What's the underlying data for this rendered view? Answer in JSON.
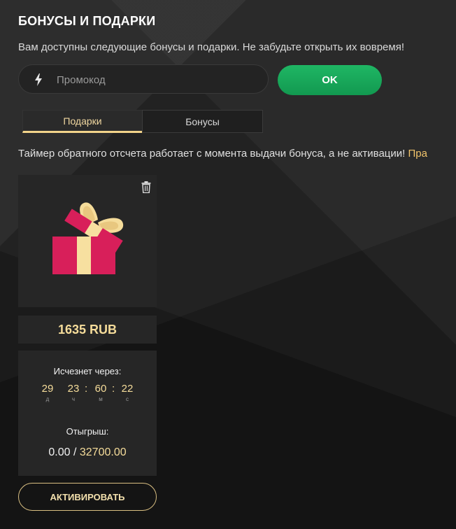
{
  "header": {
    "title": "БОНУСЫ И ПОДАРКИ",
    "subtitle": "Вам доступны следующие бонусы и подарки. Не забудьте открыть их вовремя!"
  },
  "promo": {
    "placeholder": "Промокод",
    "icon": "lightning-icon",
    "ok_label": "OK"
  },
  "tabs": [
    {
      "label": "Подарки",
      "active": true
    },
    {
      "label": "Бонусы",
      "active": false
    }
  ],
  "notice": {
    "text": "Таймер обратного отсчета работает с момента выдачи бонуса, а не активации! ",
    "link": "Пра"
  },
  "gift_card": {
    "image_icon": "gift-box-icon",
    "delete_icon": "trash-icon",
    "amount": "1635 RUB",
    "expires_label": "Исчезнет через:",
    "timer": [
      {
        "value": "29",
        "unit": "д"
      },
      {
        "value": "23",
        "unit": "ч"
      },
      {
        "value": "60",
        "unit": "м"
      },
      {
        "value": "22",
        "unit": "с"
      }
    ],
    "wager_label": "Отыгрыш:",
    "wager_current": "0.00",
    "wager_separator": " / ",
    "wager_target": "32700.00",
    "activate_label": "АКТИВИРОВАТЬ"
  },
  "colors": {
    "accent_gold": "#f5dc9a",
    "ok_green": "#14a356",
    "gift_red": "#d81f5a",
    "gift_ribbon": "#f7e0a0"
  }
}
